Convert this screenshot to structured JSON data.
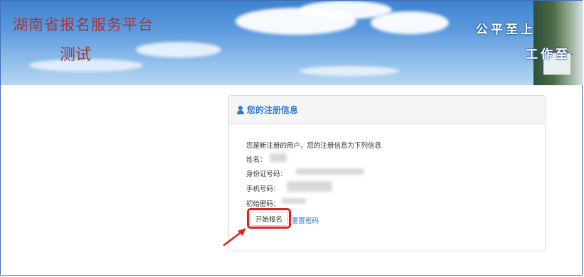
{
  "header": {
    "site_title": "湖南省报名服务平台",
    "site_subtitle": "测试",
    "slogan_line1": "公平至上",
    "slogan_line2": "工作至"
  },
  "panel": {
    "title": "您的注册信息",
    "intro": "您是新注册的用户，您的注册信息为下列信息",
    "fields": [
      {
        "label": "姓名："
      },
      {
        "label": "身份证号码："
      },
      {
        "label": "手机号码："
      },
      {
        "label": "初始密码："
      }
    ],
    "start_button": "开始报名",
    "reset_link": "重置密码"
  },
  "colors": {
    "accent": "#2a7bd0",
    "title_red": "#a7363c",
    "highlight_red": "#e02020",
    "frame_blue": "#3f6fb5"
  },
  "icons": {
    "panel_title_icon": "user-icon",
    "annotation": "red-arrow-icon"
  }
}
